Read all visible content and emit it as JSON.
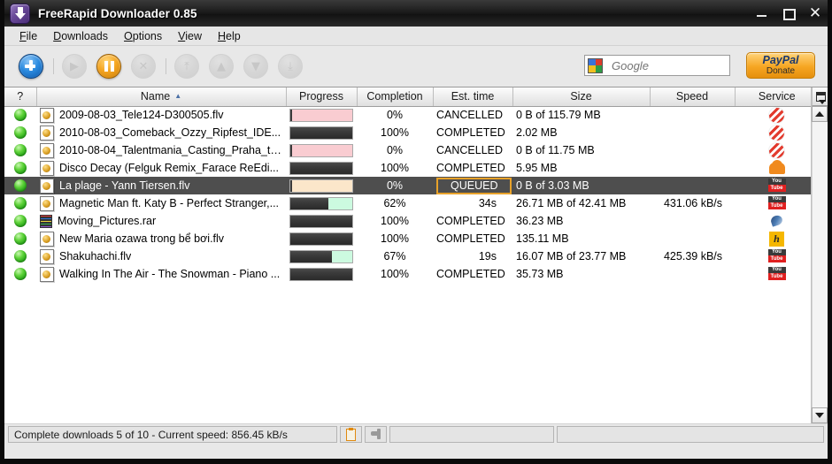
{
  "window": {
    "title": "FreeRapid Downloader 0.85",
    "app_icon": "download-arrow-icon",
    "minimize_label": "",
    "maximize_label": "",
    "close_label": "✕"
  },
  "menubar": {
    "items": [
      {
        "label": "File",
        "mnemonic": "F",
        "rest": "ile"
      },
      {
        "label": "Downloads",
        "mnemonic": "D",
        "rest": "ownloads"
      },
      {
        "label": "Options",
        "mnemonic": "O",
        "rest": "ptions"
      },
      {
        "label": "View",
        "mnemonic": "V",
        "rest": "iew"
      },
      {
        "label": "Help",
        "mnemonic": "H",
        "rest": "elp"
      }
    ]
  },
  "toolbar": {
    "buttons": [
      {
        "name": "add-new-download-button",
        "icon": "plus-icon",
        "state": "enabled"
      },
      {
        "name": "resume-download-button",
        "icon": "play-icon",
        "state": "disabled",
        "glyph": "▶"
      },
      {
        "name": "pause-download-button",
        "icon": "pause-icon",
        "state": "enabled"
      },
      {
        "name": "cancel-download-button",
        "icon": "cancel-x-icon",
        "state": "disabled",
        "glyph": "✕"
      },
      {
        "name": "move-to-top-button",
        "icon": "move-top-icon",
        "state": "disabled",
        "glyph": "⤒"
      },
      {
        "name": "move-up-button",
        "icon": "move-up-icon",
        "state": "disabled",
        "glyph": "▲"
      },
      {
        "name": "move-down-button",
        "icon": "move-down-icon",
        "state": "disabled",
        "glyph": "▼"
      },
      {
        "name": "move-to-bottom-button",
        "icon": "move-bottom-icon",
        "state": "disabled",
        "glyph": "⤓"
      }
    ],
    "search": {
      "placeholder": "Google",
      "value": "",
      "icon": "google-icon"
    },
    "paypal": {
      "line1": "PayPal",
      "line2": "Donate"
    }
  },
  "table": {
    "columns": [
      {
        "key": "flag",
        "label": "?"
      },
      {
        "key": "name",
        "label": "Name",
        "sorted": "asc",
        "sort_glyph": "▲"
      },
      {
        "key": "progress",
        "label": "Progress"
      },
      {
        "key": "completion",
        "label": "Completion"
      },
      {
        "key": "est_time",
        "label": "Est. time"
      },
      {
        "key": "size",
        "label": "Size"
      },
      {
        "key": "speed",
        "label": "Speed"
      },
      {
        "key": "service",
        "label": "Service"
      }
    ],
    "column_settings_icon": "column-settings-icon",
    "rows": [
      {
        "flag_icon": "green-status-ball-icon",
        "file_icon": "flv-file-icon",
        "name": "2009-08-03_Tele124-D300505.flv",
        "progress_percent": 0,
        "progress_state": "cancelled",
        "completion": "0%",
        "est_time": "CANCELLED",
        "size": "0 B of 115.79 MB",
        "speed": "",
        "service_icon": "striped-red-service-icon",
        "selected": false
      },
      {
        "flag_icon": "green-status-ball-icon",
        "file_icon": "flv-file-icon",
        "name": "2010-08-03_Comeback_Ozzy_Ripfest_IDE...",
        "progress_percent": 100,
        "progress_state": "completed",
        "completion": "100%",
        "est_time": "COMPLETED",
        "size": "2.02 MB",
        "speed": "",
        "service_icon": "striped-red-service-icon",
        "selected": false
      },
      {
        "flag_icon": "green-status-ball-icon",
        "file_icon": "flv-file-icon",
        "name": "2010-08-04_Talentmania_Casting_Praha_tn...",
        "progress_percent": 0,
        "progress_state": "cancelled",
        "completion": "0%",
        "est_time": "CANCELLED",
        "size": "0 B of 11.75 MB",
        "speed": "",
        "service_icon": "striped-red-service-icon",
        "selected": false
      },
      {
        "flag_icon": "green-status-ball-icon",
        "file_icon": "flv-file-icon",
        "name": "Disco Decay (Felguk Remix_Farace ReEdi...",
        "progress_percent": 100,
        "progress_state": "completed",
        "completion": "100%",
        "est_time": "COMPLETED",
        "size": "5.95 MB",
        "speed": "",
        "service_icon": "soundcloud-service-icon",
        "selected": false
      },
      {
        "flag_icon": "green-status-ball-icon",
        "file_icon": "flv-file-icon",
        "name": "La plage - Yann Tiersen.flv",
        "progress_percent": 0,
        "progress_state": "queued",
        "completion": "0%",
        "est_time": "QUEUED",
        "size": "0 B of 3.03 MB",
        "speed": "",
        "service_icon": "youtube-service-icon",
        "selected": true
      },
      {
        "flag_icon": "green-status-ball-icon",
        "file_icon": "flv-file-icon",
        "name": "Magnetic Man ft. Katy B - Perfect Stranger,...",
        "progress_percent": 62,
        "progress_state": "running",
        "completion": "62%",
        "est_time": "34s",
        "size": "26.71 MB of 42.41 MB",
        "speed": "431.06 kB/s",
        "service_icon": "youtube-service-icon",
        "selected": false
      },
      {
        "flag_icon": "green-status-ball-icon",
        "file_icon": "rar-archive-icon",
        "name": "Moving_Pictures.rar",
        "progress_percent": 100,
        "progress_state": "completed",
        "completion": "100%",
        "est_time": "COMPLETED",
        "size": "36.23 MB",
        "speed": "",
        "service_icon": "rapidshare-service-icon",
        "selected": false
      },
      {
        "flag_icon": "green-status-ball-icon",
        "file_icon": "flv-file-icon",
        "name": "New Maria ozawa trong bể bơi.flv",
        "progress_percent": 100,
        "progress_state": "completed",
        "completion": "100%",
        "est_time": "COMPLETED",
        "size": "135.11 MB",
        "speed": "",
        "service_icon": "hotfile-service-icon",
        "selected": false
      },
      {
        "flag_icon": "green-status-ball-icon",
        "file_icon": "flv-file-icon",
        "name": "Shakuhachi.flv",
        "progress_percent": 67,
        "progress_state": "running",
        "completion": "67%",
        "est_time": "19s",
        "size": "16.07 MB of 23.77 MB",
        "speed": "425.39 kB/s",
        "service_icon": "youtube-service-icon",
        "selected": false
      },
      {
        "flag_icon": "green-status-ball-icon",
        "file_icon": "flv-file-icon",
        "name": "Walking In The Air - The Snowman - Piano ...",
        "progress_percent": 100,
        "progress_state": "completed",
        "completion": "100%",
        "est_time": "COMPLETED",
        "size": "35.73 MB",
        "speed": "",
        "service_icon": "youtube-service-icon",
        "selected": false
      }
    ]
  },
  "scrollbar": {
    "up_glyph": "▲",
    "down_glyph": "▼"
  },
  "statusbar": {
    "message": "Complete downloads 5 of 10 - Current speed: 856.45 kB/s",
    "clipboard_icon": "clipboard-monitor-icon",
    "speed_icon": "speed-limiter-tap-icon",
    "panel3": "",
    "panel4": ""
  },
  "colors": {
    "accent_blue": "#2d8ce0",
    "accent_orange": "#f5a623",
    "cancelled_pink": "#f9ccd1",
    "queued_peach": "#fbe6ca",
    "running_mint": "#ccfae0",
    "progress_dark": "#3a3a3a",
    "selection_gray": "#4e4e4e",
    "status_green": "#5fd43a"
  }
}
